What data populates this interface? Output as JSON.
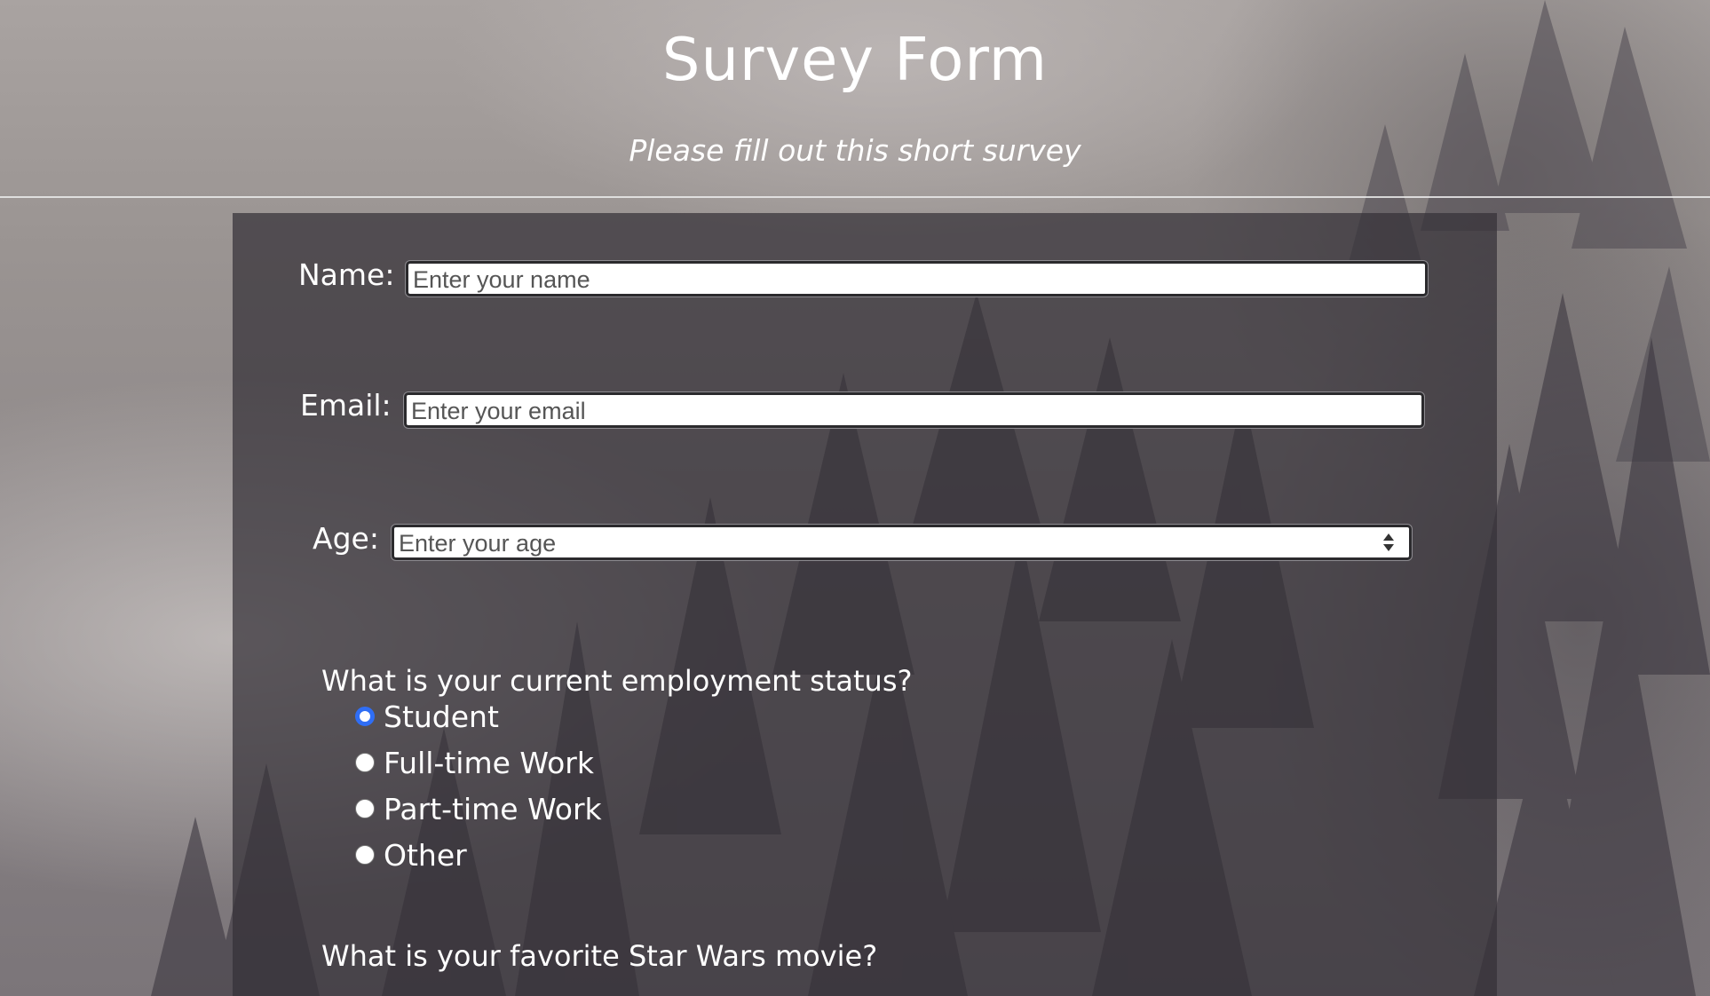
{
  "header": {
    "title": "Survey Form",
    "subtitle": "Please fill out this short survey"
  },
  "form": {
    "name": {
      "label": "Name:",
      "placeholder": "Enter your name"
    },
    "email": {
      "label": "Email:",
      "placeholder": "Enter your email"
    },
    "age": {
      "label": "Age:",
      "placeholder": "Enter your age"
    },
    "employment": {
      "question": "What is your current employment status?",
      "options": [
        {
          "label": "Student",
          "checked": true
        },
        {
          "label": "Full-time Work",
          "checked": false
        },
        {
          "label": "Part-time Work",
          "checked": false
        },
        {
          "label": "Other",
          "checked": false
        }
      ]
    },
    "movie": {
      "question": "What is your favorite Star Wars movie?"
    }
  },
  "colors": {
    "radio_selected": "#2f6ef5",
    "panel": "#343038"
  },
  "icons": {
    "age_spinner": "number-spinner-icon"
  }
}
